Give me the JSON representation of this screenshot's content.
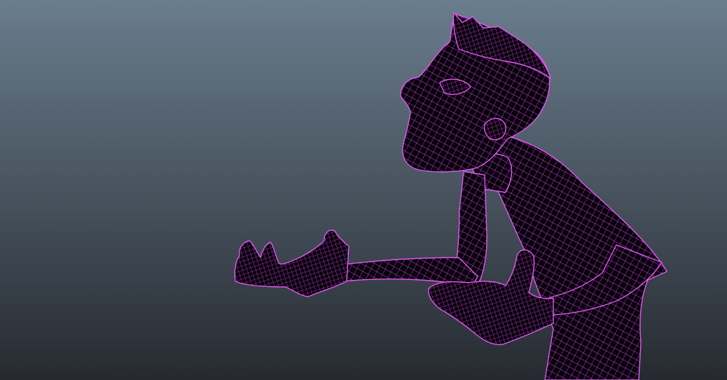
{
  "viewport": {
    "background_top": "#6a7d8e",
    "background_bottom": "#262a30"
  },
  "model": {
    "wire_color": "#d23ce6",
    "fill_color": "#07040a"
  }
}
